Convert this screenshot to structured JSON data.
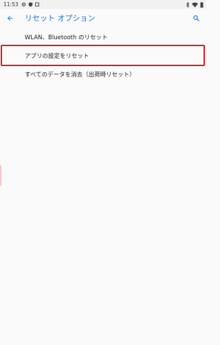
{
  "status_bar": {
    "time": "11:53",
    "left_icons": [
      "gear-icon",
      "shield-icon",
      "square-icon"
    ],
    "right_icons": [
      "bluetooth-icon",
      "wifi-icon",
      "battery-icon"
    ]
  },
  "app_bar": {
    "title": "リセット オプション",
    "accent_color": "#1a73e8"
  },
  "options": [
    {
      "label": "WLAN、Bluetooth のリセット"
    },
    {
      "label": "アプリの設定をリセット"
    },
    {
      "label": "すべてのデータを消去（出荷時リセット）"
    }
  ],
  "highlight_color": "#e8141a"
}
